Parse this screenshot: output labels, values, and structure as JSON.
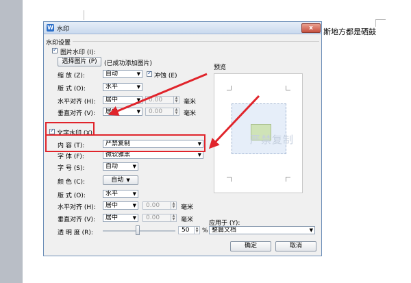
{
  "document": {
    "background_text": "斯地方都是硒鼓"
  },
  "dialog": {
    "title": "水印",
    "close_label": "x",
    "group_label": "水印设置",
    "picture": {
      "checkbox_label": "图片水印 (I):",
      "checked": true,
      "select_button": "选择图片 (P)",
      "status": "(已成功添加图片)",
      "scale_label": "缩    放 (Z):",
      "scale_value": "自动",
      "washout_label": "冲蚀 (E)",
      "washout_checked": true,
      "layout_label": "版    式 (O):",
      "layout_value": "水平",
      "halign_label": "水平对齐 (H):",
      "halign_value": "居中",
      "halign_num": "0.00",
      "valign_label": "垂直对齐 (V):",
      "valign_value": "居中",
      "valign_num": "0.00",
      "unit": "毫米"
    },
    "text": {
      "checkbox_label": "文字水印 (X)",
      "checked": true,
      "content_label": "内    容 (T):",
      "content_value": "严禁复制",
      "font_label": "字    体 (F):",
      "font_value": "微软雅黑",
      "size_label": "字    号 (S):",
      "size_value": "自动",
      "color_label": "颜    色 (C):",
      "color_value": "自动",
      "layout_label": "版    式 (O):",
      "layout_value": "水平",
      "halign_label": "水平对齐 (H):",
      "halign_value": "居中",
      "halign_num": "0.00",
      "valign_label": "垂直对齐 (V):",
      "valign_value": "居中",
      "valign_num": "0.00",
      "unit": "毫米",
      "opacity_label": "透 明 度 (R):",
      "opacity_value": "50",
      "opacity_unit": "%"
    },
    "preview": {
      "label": "预览",
      "watermark_text": "严禁复制"
    },
    "apply": {
      "label": "应用于 (Y):",
      "value": "整篇文档"
    },
    "ok_label": "确定",
    "cancel_label": "取消"
  },
  "colors": {
    "annotation_red": "#e0242b",
    "title_bar": "#c9d9ee"
  }
}
